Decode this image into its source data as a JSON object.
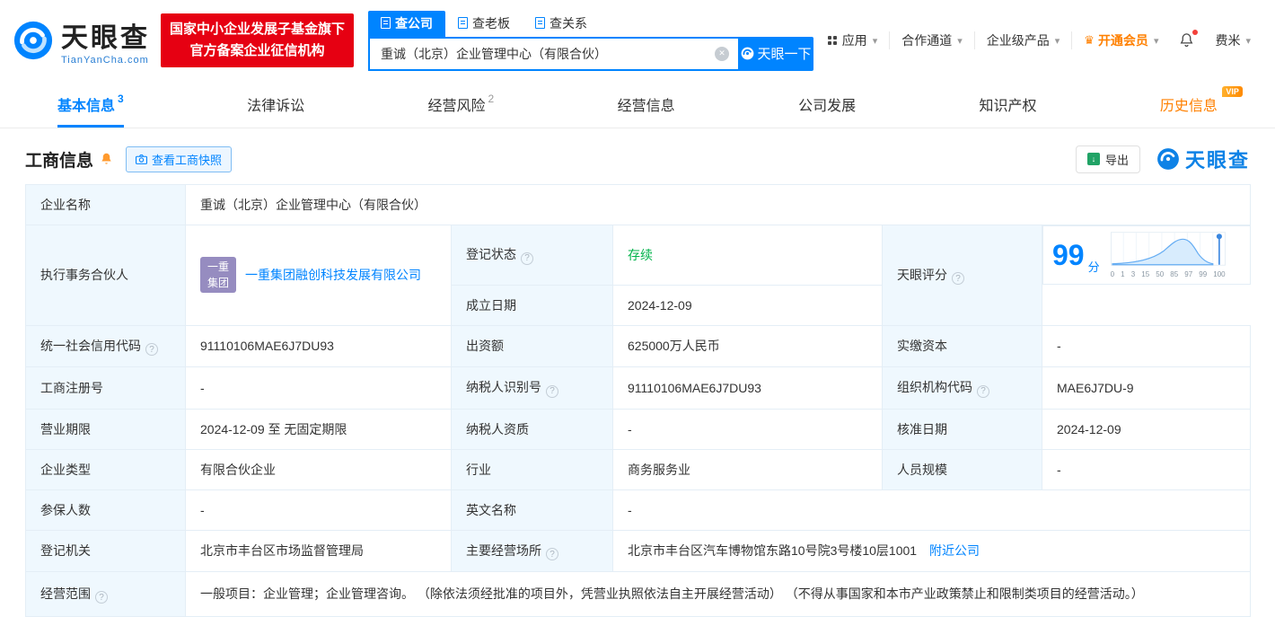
{
  "colors": {
    "brand_blue": "#0084ff",
    "badge_red": "#e60012",
    "status_green": "#00b34a",
    "vip_orange": "#ff8000",
    "partner_logo_purple": "#968cc0"
  },
  "icons": {
    "caret-down": "▾",
    "help": "?",
    "clear": "✕",
    "crown": "♛",
    "export-arrow": "↓"
  },
  "header": {
    "brand": "天眼查",
    "brand_domain": "TianYanCha.com",
    "badge": {
      "line1": "国家中小企业发展子基金旗下",
      "line2": "官方备案企业征信机构"
    },
    "search_tabs": [
      {
        "label": "查公司"
      },
      {
        "label": "查老板"
      },
      {
        "label": "查关系"
      }
    ],
    "search": {
      "value": "重诚（北京）企业管理中心（有限合伙）",
      "button": "天眼一下"
    },
    "nav": {
      "apps": "应用",
      "partnership": "合作通道",
      "enterprise": "企业级产品",
      "vip": "开通会员",
      "user": "费米"
    }
  },
  "tabs": [
    {
      "label": "基本信息",
      "count": "3"
    },
    {
      "label": "法律诉讼"
    },
    {
      "label": "经营风险",
      "count": "2"
    },
    {
      "label": "经营信息"
    },
    {
      "label": "公司发展"
    },
    {
      "label": "知识产权"
    },
    {
      "label": "历史信息",
      "badge": "VIP"
    }
  ],
  "section": {
    "title": "工商信息",
    "snapshot_button": "查看工商快照",
    "export_button": "导出",
    "corner_logo": "天眼查"
  },
  "score": {
    "value": "99",
    "unit": "分",
    "axis": [
      "0",
      "1",
      "3",
      "15",
      "50",
      "85",
      "97",
      "99",
      "100"
    ]
  },
  "partner_logo": {
    "line1": "一重",
    "line2": "集团"
  },
  "links": {
    "nearby": "附近公司"
  },
  "fields": {
    "company_name": {
      "label": "企业名称",
      "value": "重诚（北京）企业管理中心（有限合伙）"
    },
    "executive_partner": {
      "label": "执行事务合伙人",
      "value": "一重集团融创科技发展有限公司"
    },
    "reg_status": {
      "label": "登记状态",
      "value": "存续"
    },
    "establish_date": {
      "label": "成立日期",
      "value": "2024-12-09"
    },
    "score": {
      "label": "天眼评分"
    },
    "credit_code": {
      "label": "统一社会信用代码",
      "value": "91110106MAE6J7DU93"
    },
    "capital": {
      "label": "出资额",
      "value": "625000万人民币"
    },
    "paid_capital": {
      "label": "实缴资本",
      "value": "-"
    },
    "reg_number": {
      "label": "工商注册号",
      "value": "-"
    },
    "taxpayer_id": {
      "label": "纳税人识别号",
      "value": "91110106MAE6J7DU93"
    },
    "org_code": {
      "label": "组织机构代码",
      "value": "MAE6J7DU-9"
    },
    "business_term": {
      "label": "营业期限",
      "value": "2024-12-09 至 无固定期限"
    },
    "taxpayer_quality": {
      "label": "纳税人资质",
      "value": "-"
    },
    "approval_date": {
      "label": "核准日期",
      "value": "2024-12-09"
    },
    "company_type": {
      "label": "企业类型",
      "value": "有限合伙企业"
    },
    "industry": {
      "label": "行业",
      "value": "商务服务业"
    },
    "staff_size": {
      "label": "人员规模",
      "value": "-"
    },
    "insured_count": {
      "label": "参保人数",
      "value": "-"
    },
    "english_name": {
      "label": "英文名称",
      "value": "-"
    },
    "reg_authority": {
      "label": "登记机关",
      "value": "北京市丰台区市场监督管理局"
    },
    "business_address": {
      "label": "主要经营场所",
      "value": "北京市丰台区汽车博物馆东路10号院3号楼10层1001"
    },
    "business_scope": {
      "label": "经营范围",
      "value": "一般项目：企业管理；企业管理咨询。 （除依法须经批准的项目外，凭营业执照依法自主开展经营活动） （不得从事国家和本市产业政策禁止和限制类项目的经营活动。）"
    }
  }
}
